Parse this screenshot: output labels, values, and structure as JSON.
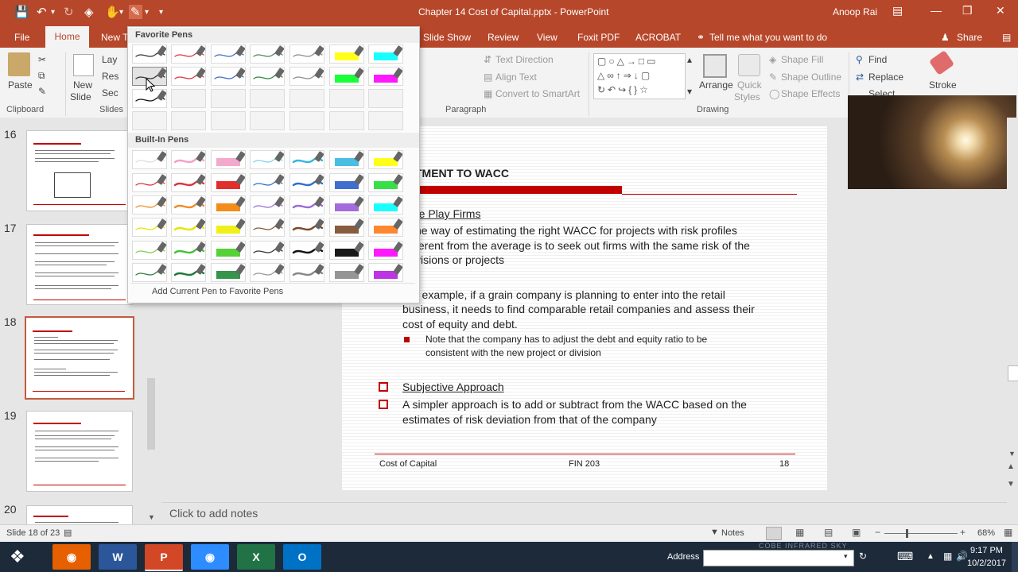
{
  "window": {
    "title": "Chapter 14 Cost of Capital.pptx - PowerPoint",
    "user": "Anoop Rai"
  },
  "tabs": [
    {
      "label": "File"
    },
    {
      "label": "Home"
    },
    {
      "label": "New T"
    },
    {
      "label": "Slide Show"
    },
    {
      "label": "Review"
    },
    {
      "label": "View"
    },
    {
      "label": "Foxit PDF"
    },
    {
      "label": "ACROBAT"
    }
  ],
  "tell_me": "Tell me what you want to do",
  "share": "Share",
  "ribbon": {
    "paste": "Paste",
    "new_slide_1": "New",
    "new_slide_2": "Slide",
    "layout_trunc": "Lay",
    "reset_trunc": "Res",
    "section_trunc": "Sec",
    "clipboard": "Clipboard",
    "slides": "Slides",
    "text_direction": "Text Direction",
    "align_text": "Align Text",
    "convert_smartart": "Convert to SmartArt",
    "paragraph": "Paragraph",
    "arrange": "Arrange",
    "quick_styles_1": "Quick",
    "quick_styles_2": "Styles",
    "shape_fill": "Shape Fill",
    "shape_outline": "Shape Outline",
    "shape_effects": "Shape Effects",
    "drawing": "Drawing",
    "find": "Find",
    "replace": "Replace",
    "select": "Select",
    "stroke": "Stroke"
  },
  "pen_gallery": {
    "favorite_header": "Favorite Pens",
    "builtin_header": "Built-In Pens",
    "add_link": "Add Current Pen to Favorite Pens",
    "favorites": [
      [
        "#333333",
        "#d9363e",
        "#3c6fc3",
        "#4a8a5a",
        "#8a8a8a",
        "#ffff00",
        "#00ffff"
      ],
      [
        "#333333",
        "#d9363e",
        "#3c6fc3",
        "#2e8b3e",
        "#8a8a8a",
        "#00ff22",
        "#ff00ff"
      ],
      [
        "#111111",
        "",
        "",
        "",
        "",
        "",
        ""
      ],
      [
        "",
        "",
        "",
        "",
        "",
        "",
        ""
      ]
    ],
    "builtin": [
      [
        "#dddddd",
        "#f2a0c8",
        "#f2a0c8",
        "#7fd4e8",
        "#36b6e0",
        "#36b6e0",
        "#ffff00"
      ],
      [
        "#d9363e",
        "#d9363e",
        "#e01515",
        "#2a73c9",
        "#2a73c9",
        "#2a5fc9",
        "#22dd33"
      ],
      [
        "#f08b2a",
        "#f08b2a",
        "#f28000",
        "#9b6bd6",
        "#9b6bd6",
        "#9b5bd8",
        "#00ffff"
      ],
      [
        "#e6e600",
        "#e6e600",
        "#eeee00",
        "#8a5a3a",
        "#7a4a2a",
        "#7a4a2a",
        "#ff7a1a"
      ],
      [
        "#7cd14a",
        "#44c23a",
        "#44cc22",
        "#333333",
        "#111111",
        "#000000",
        "#ff00ff"
      ],
      [
        "#2e7d3e",
        "#207838",
        "#208838",
        "#999999",
        "#888888",
        "#8a8a8a",
        "#b51fe0"
      ]
    ]
  },
  "slide": {
    "title": "TMENT TO WACC",
    "heading1": "re Play Firms",
    "b1_l1": "ne way of estimating the right WACC for projects with risk profiles",
    "b1_l2": "ferent from the average is to seek out firms with the same risk of the",
    "b1_l3": "visions or projects",
    "b2_l1": "r example, if a grain company is planning to enter into the retail",
    "b2_l2": "business, it needs to find comparable retail companies and assess their",
    "b2_l3": "cost of equity and debt.",
    "sub_l1": "Note that the company has to adjust the debt and equity ratio to be",
    "sub_l2": "consistent with the new project or division",
    "heading2": "Subjective Approach",
    "b3_l1": "A simpler approach is to add or subtract from the WACC based on the",
    "b3_l2": "estimates of risk deviation from that of the company",
    "footer_left": "Cost of Capital",
    "footer_center": "FIN 203",
    "footer_right": "18"
  },
  "thumbnails": [
    {
      "num": "16"
    },
    {
      "num": "17"
    },
    {
      "num": "18"
    },
    {
      "num": "19"
    },
    {
      "num": "20"
    }
  ],
  "notes_placeholder": "Click to add notes",
  "status": {
    "slide_info": "Slide 18 of 23",
    "notes": "Notes",
    "zoom": "68%"
  },
  "taskbar": {
    "address_label": "Address",
    "watermark": "COBE INFRARED SKY",
    "time": "9:17 PM",
    "date": "10/2/2017"
  },
  "colors": {
    "accent": "#b7472a",
    "slide_red": "#c00000"
  }
}
